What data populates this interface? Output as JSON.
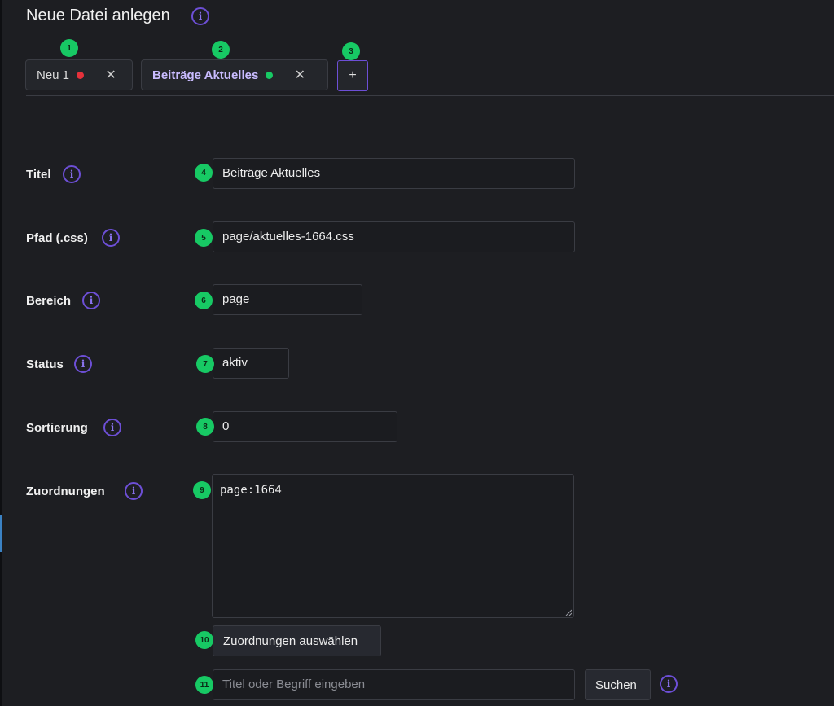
{
  "header": {
    "title": "Neue Datei anlegen",
    "info_icon": "i"
  },
  "tabs": [
    {
      "label": "Neu 1",
      "status_color": "#e5313b",
      "close": "✕",
      "marker": "1"
    },
    {
      "label": "Beiträge Aktuelles",
      "status_color": "#17c964",
      "close": "✕",
      "marker": "2"
    }
  ],
  "add_tab": {
    "label": "+",
    "marker": "3"
  },
  "form": {
    "titel": {
      "label": "Titel",
      "value": "Beiträge Aktuelles",
      "marker": "4"
    },
    "pfad": {
      "label": "Pfad (.css)",
      "value": "page/aktuelles-1664.css",
      "marker": "5"
    },
    "bereich": {
      "label": "Bereich",
      "value": "page",
      "marker": "6"
    },
    "status": {
      "label": "Status",
      "value": "aktiv",
      "marker": "7"
    },
    "sortierung": {
      "label": "Sortierung",
      "value": "0",
      "marker": "8"
    },
    "zuordnungen": {
      "label": "Zuordnungen",
      "value": "page:1664",
      "marker": "9"
    }
  },
  "assign_button": {
    "label": "Zuordnungen auswählen",
    "marker": "10"
  },
  "search": {
    "placeholder": "Titel oder Begriff eingeben",
    "button_label": "Suchen",
    "marker": "11"
  },
  "colors": {
    "accent": "#6d4fd6",
    "badge": "#17c964",
    "background": "#1d1e22"
  }
}
